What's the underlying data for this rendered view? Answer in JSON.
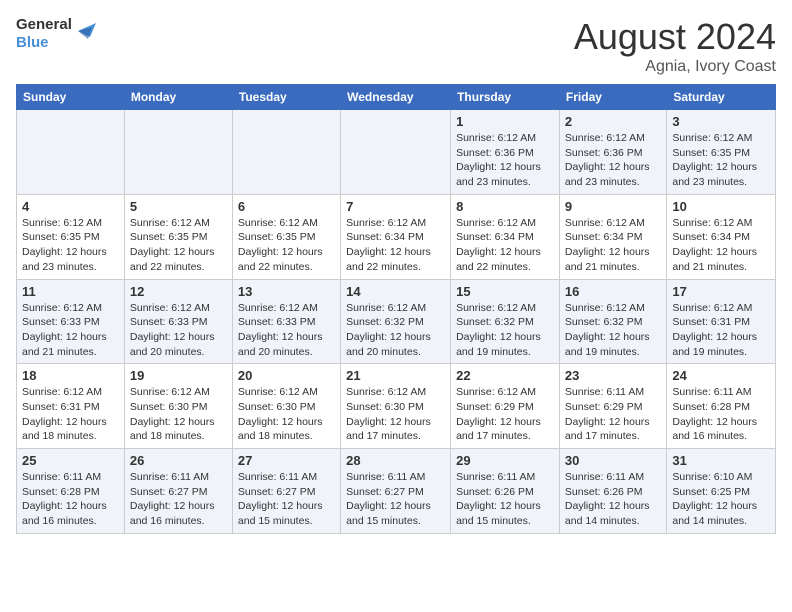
{
  "logo": {
    "line1": "General",
    "line2": "Blue"
  },
  "title": "August 2024",
  "subtitle": "Agnia, Ivory Coast",
  "weekdays": [
    "Sunday",
    "Monday",
    "Tuesday",
    "Wednesday",
    "Thursday",
    "Friday",
    "Saturday"
  ],
  "weeks": [
    [
      {
        "day": "",
        "detail": ""
      },
      {
        "day": "",
        "detail": ""
      },
      {
        "day": "",
        "detail": ""
      },
      {
        "day": "",
        "detail": ""
      },
      {
        "day": "1",
        "detail": "Sunrise: 6:12 AM\nSunset: 6:36 PM\nDaylight: 12 hours\nand 23 minutes."
      },
      {
        "day": "2",
        "detail": "Sunrise: 6:12 AM\nSunset: 6:36 PM\nDaylight: 12 hours\nand 23 minutes."
      },
      {
        "day": "3",
        "detail": "Sunrise: 6:12 AM\nSunset: 6:35 PM\nDaylight: 12 hours\nand 23 minutes."
      }
    ],
    [
      {
        "day": "4",
        "detail": "Sunrise: 6:12 AM\nSunset: 6:35 PM\nDaylight: 12 hours\nand 23 minutes."
      },
      {
        "day": "5",
        "detail": "Sunrise: 6:12 AM\nSunset: 6:35 PM\nDaylight: 12 hours\nand 22 minutes."
      },
      {
        "day": "6",
        "detail": "Sunrise: 6:12 AM\nSunset: 6:35 PM\nDaylight: 12 hours\nand 22 minutes."
      },
      {
        "day": "7",
        "detail": "Sunrise: 6:12 AM\nSunset: 6:34 PM\nDaylight: 12 hours\nand 22 minutes."
      },
      {
        "day": "8",
        "detail": "Sunrise: 6:12 AM\nSunset: 6:34 PM\nDaylight: 12 hours\nand 22 minutes."
      },
      {
        "day": "9",
        "detail": "Sunrise: 6:12 AM\nSunset: 6:34 PM\nDaylight: 12 hours\nand 21 minutes."
      },
      {
        "day": "10",
        "detail": "Sunrise: 6:12 AM\nSunset: 6:34 PM\nDaylight: 12 hours\nand 21 minutes."
      }
    ],
    [
      {
        "day": "11",
        "detail": "Sunrise: 6:12 AM\nSunset: 6:33 PM\nDaylight: 12 hours\nand 21 minutes."
      },
      {
        "day": "12",
        "detail": "Sunrise: 6:12 AM\nSunset: 6:33 PM\nDaylight: 12 hours\nand 20 minutes."
      },
      {
        "day": "13",
        "detail": "Sunrise: 6:12 AM\nSunset: 6:33 PM\nDaylight: 12 hours\nand 20 minutes."
      },
      {
        "day": "14",
        "detail": "Sunrise: 6:12 AM\nSunset: 6:32 PM\nDaylight: 12 hours\nand 20 minutes."
      },
      {
        "day": "15",
        "detail": "Sunrise: 6:12 AM\nSunset: 6:32 PM\nDaylight: 12 hours\nand 19 minutes."
      },
      {
        "day": "16",
        "detail": "Sunrise: 6:12 AM\nSunset: 6:32 PM\nDaylight: 12 hours\nand 19 minutes."
      },
      {
        "day": "17",
        "detail": "Sunrise: 6:12 AM\nSunset: 6:31 PM\nDaylight: 12 hours\nand 19 minutes."
      }
    ],
    [
      {
        "day": "18",
        "detail": "Sunrise: 6:12 AM\nSunset: 6:31 PM\nDaylight: 12 hours\nand 18 minutes."
      },
      {
        "day": "19",
        "detail": "Sunrise: 6:12 AM\nSunset: 6:30 PM\nDaylight: 12 hours\nand 18 minutes."
      },
      {
        "day": "20",
        "detail": "Sunrise: 6:12 AM\nSunset: 6:30 PM\nDaylight: 12 hours\nand 18 minutes."
      },
      {
        "day": "21",
        "detail": "Sunrise: 6:12 AM\nSunset: 6:30 PM\nDaylight: 12 hours\nand 17 minutes."
      },
      {
        "day": "22",
        "detail": "Sunrise: 6:12 AM\nSunset: 6:29 PM\nDaylight: 12 hours\nand 17 minutes."
      },
      {
        "day": "23",
        "detail": "Sunrise: 6:11 AM\nSunset: 6:29 PM\nDaylight: 12 hours\nand 17 minutes."
      },
      {
        "day": "24",
        "detail": "Sunrise: 6:11 AM\nSunset: 6:28 PM\nDaylight: 12 hours\nand 16 minutes."
      }
    ],
    [
      {
        "day": "25",
        "detail": "Sunrise: 6:11 AM\nSunset: 6:28 PM\nDaylight: 12 hours\nand 16 minutes."
      },
      {
        "day": "26",
        "detail": "Sunrise: 6:11 AM\nSunset: 6:27 PM\nDaylight: 12 hours\nand 16 minutes."
      },
      {
        "day": "27",
        "detail": "Sunrise: 6:11 AM\nSunset: 6:27 PM\nDaylight: 12 hours\nand 15 minutes."
      },
      {
        "day": "28",
        "detail": "Sunrise: 6:11 AM\nSunset: 6:27 PM\nDaylight: 12 hours\nand 15 minutes."
      },
      {
        "day": "29",
        "detail": "Sunrise: 6:11 AM\nSunset: 6:26 PM\nDaylight: 12 hours\nand 15 minutes."
      },
      {
        "day": "30",
        "detail": "Sunrise: 6:11 AM\nSunset: 6:26 PM\nDaylight: 12 hours\nand 14 minutes."
      },
      {
        "day": "31",
        "detail": "Sunrise: 6:10 AM\nSunset: 6:25 PM\nDaylight: 12 hours\nand 14 minutes."
      }
    ]
  ]
}
